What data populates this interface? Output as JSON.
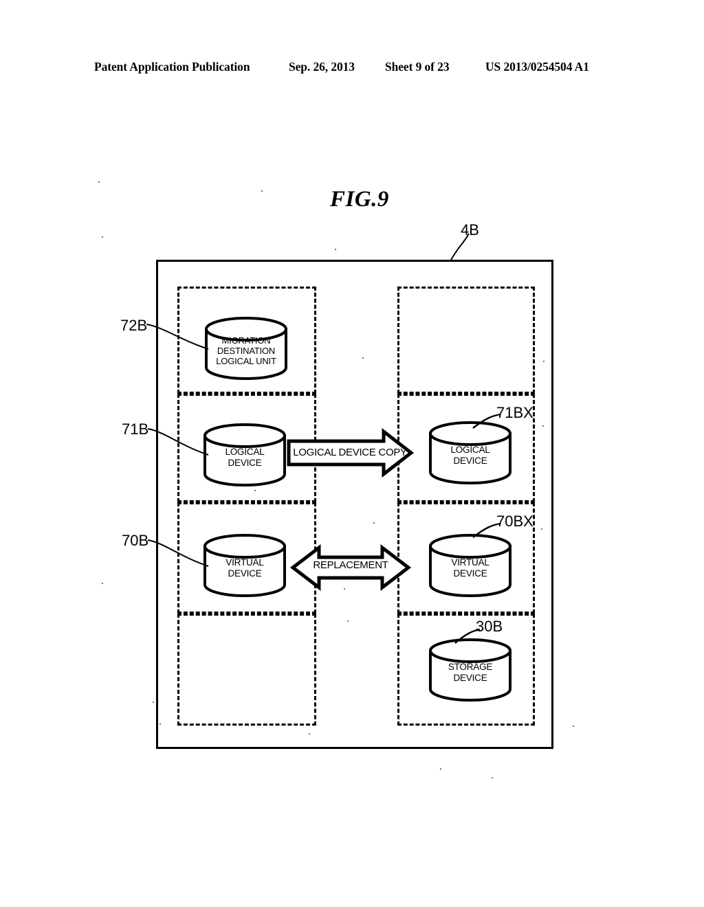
{
  "header": {
    "publication": "Patent Application Publication",
    "date": "Sep. 26, 2013",
    "sheet": "Sheet 9 of 23",
    "patent_number": "US 2013/0254504 A1"
  },
  "figure": {
    "title": "FIG.9",
    "outer_label": "4B"
  },
  "nodes": {
    "migration_destination": {
      "label_line1": "MIGRATION",
      "label_line2": "DESTINATION",
      "label_line3": "LOGICAL UNIT",
      "ref": "72B"
    },
    "logical_device_left": {
      "label_line1": "LOGICAL",
      "label_line2": "DEVICE",
      "ref": "71B"
    },
    "logical_device_right": {
      "label_line1": "LOGICAL",
      "label_line2": "DEVICE",
      "ref": "71BX"
    },
    "virtual_device_left": {
      "label_line1": "VIRTUAL",
      "label_line2": "DEVICE",
      "ref": "70B"
    },
    "virtual_device_right": {
      "label_line1": "VIRTUAL",
      "label_line2": "DEVICE",
      "ref": "70BX"
    },
    "storage_device": {
      "label_line1": "STORAGE",
      "label_line2": "DEVICE",
      "ref": "30B"
    }
  },
  "arrows": {
    "logical_device_copy": {
      "label": "LOGICAL DEVICE COPY",
      "direction": "right"
    },
    "replacement": {
      "label": "REPLACEMENT",
      "direction": "bidirectional"
    }
  },
  "colors": {
    "ink": "#000000",
    "paper": "#ffffff"
  }
}
